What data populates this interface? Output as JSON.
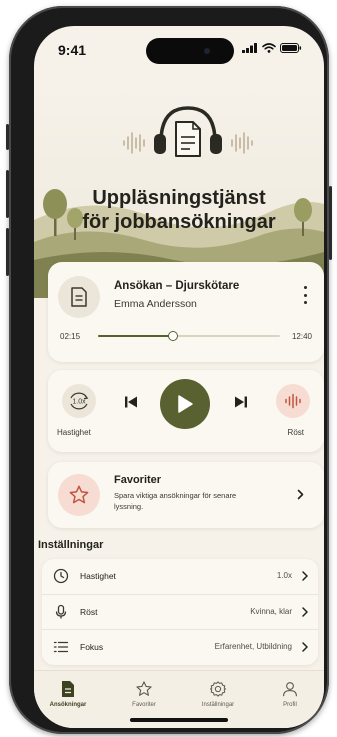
{
  "status": {
    "time": "9:41"
  },
  "hero": {
    "title_line1": "Uppläsningstjänst",
    "title_line2": "för jobbansökningar"
  },
  "player": {
    "title": "Ansökan – Djurskötare",
    "subtitle": "Emma Andersson",
    "time_current": "02:15",
    "time_total": "12:40",
    "progress_fraction": 0.41
  },
  "controls": {
    "speed_badge": "1.0x",
    "speed_label": "Hastighet",
    "voice_label": "Röst"
  },
  "favorites": {
    "title": "Favoriter",
    "description": "Spara viktiga ansökningar för senare lyssning."
  },
  "settings": {
    "title": "Inställningar",
    "rows": [
      {
        "label": "Hastighet",
        "value": "1.0x",
        "icon": "clock-icon"
      },
      {
        "label": "Röst",
        "value": "Kvinna, klar",
        "icon": "microphone-icon"
      },
      {
        "label": "Fokus",
        "value": "Erfarenhet, Utbildning",
        "icon": "list-icon"
      }
    ]
  },
  "tabs": [
    {
      "label": "Ansökningar",
      "icon": "document-icon",
      "active": true
    },
    {
      "label": "Favoriter",
      "icon": "star-icon",
      "active": false
    },
    {
      "label": "Inställningar",
      "icon": "gear-icon",
      "active": false
    },
    {
      "label": "Profil",
      "icon": "person-icon",
      "active": false
    }
  ],
  "colors": {
    "accent": "#5a6131",
    "background": "#f6f2ea",
    "card": "#fbf8f2",
    "voice_accent": "#c2553e",
    "favorite_accent": "#c2553e"
  }
}
